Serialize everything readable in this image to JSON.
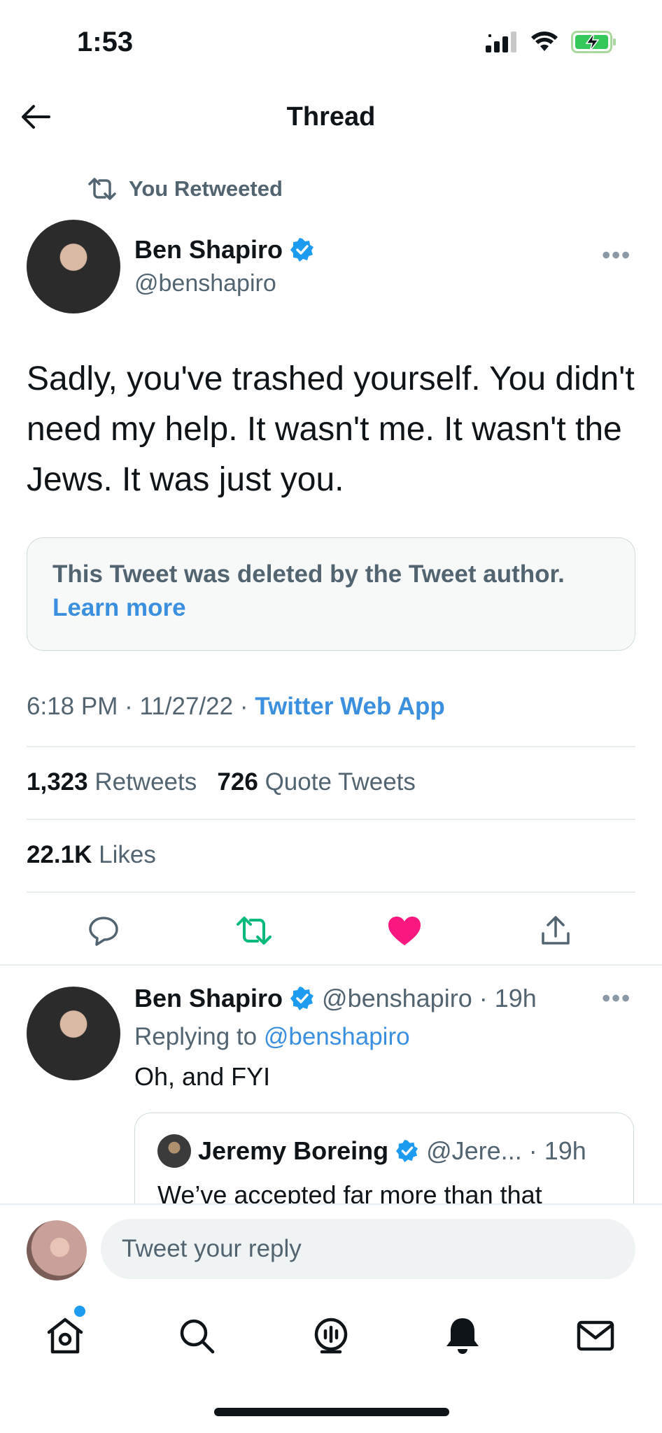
{
  "status_bar": {
    "time": "1:53"
  },
  "header": {
    "title": "Thread"
  },
  "retweet_context": {
    "label": "You Retweeted"
  },
  "main_tweet": {
    "author_name": "Ben Shapiro",
    "author_handle": "@benshapiro",
    "text": "Sadly, you've trashed yourself. You didn't need my help. It wasn't me. It wasn't the Jews. It was just you.",
    "deleted_notice": "This Tweet was deleted by the Tweet author.",
    "learn_more": "Learn more",
    "time": "6:18 PM · 11/27/22 · ",
    "source": "Twitter Web App",
    "retweets_count": "1,323",
    "retweets_label": "Retweets",
    "quotes_count": "726",
    "quotes_label": "Quote Tweets",
    "likes_count": "22.1K",
    "likes_label": "Likes"
  },
  "reply": {
    "author_name": "Ben Shapiro",
    "author_handle": "@benshapiro",
    "time": "· 19h",
    "replying_label": "Replying to",
    "replying_handle": "@benshapiro",
    "text": "Oh, and FYI",
    "quote": {
      "author_name": "Jeremy Boreing",
      "author_handle": "@Jere...",
      "time": "· 19h",
      "text": "We’ve accepted far more than that"
    }
  },
  "composer": {
    "placeholder": "Tweet your reply"
  },
  "colors": {
    "accent": "#1d9bf0",
    "like": "#f91880",
    "retweet": "#00ba7c"
  },
  "tab_bar": [
    "home-icon",
    "search-icon",
    "spaces-icon",
    "notifications-icon",
    "messages-icon"
  ]
}
